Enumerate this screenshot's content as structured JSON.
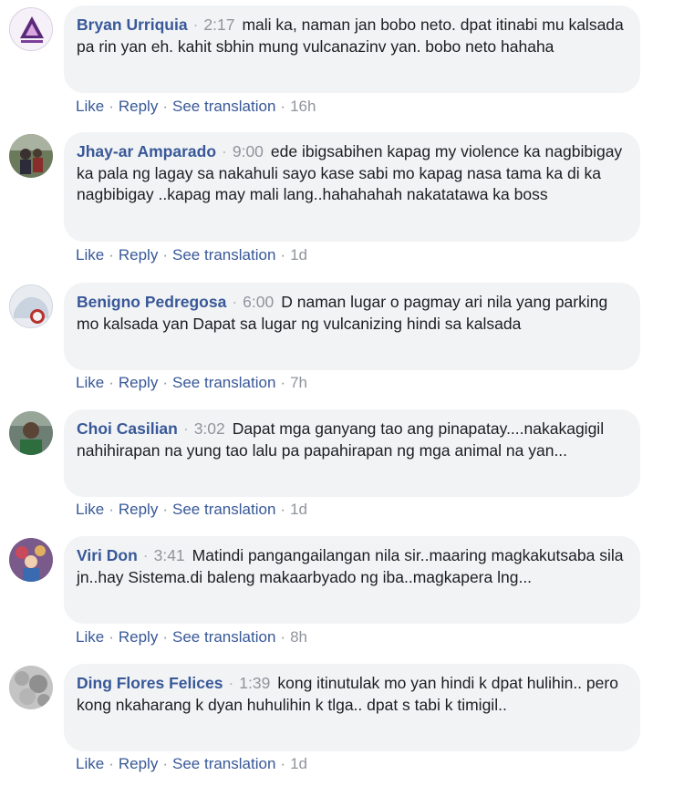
{
  "comments": [
    {
      "author": "Bryan Urriquia",
      "time": "2:17",
      "text": "mali ka, naman jan bobo neto. dpat itinabi mu kalsada pa rin yan eh. kahit sbhin mung vulcanazinv yan. bobo neto hahaha",
      "age": "16h"
    },
    {
      "author": "Jhay-ar Amparado",
      "time": "9:00",
      "text": "ede ibigsabihen kapag my violence ka nagbibigay ka pala ng lagay sa nakahuli sayo kase sabi mo kapag nasa tama ka di ka nagbibigay ..kapag may mali lang..hahahahah nakatatawa ka boss",
      "age": "1d"
    },
    {
      "author": "Benigno Pedregosa",
      "time": "6:00",
      "text": "D naman lugar o pagmay ari nila yang parking mo kalsada yan Dapat sa lugar ng vulcanizing hindi sa kalsada",
      "age": "7h"
    },
    {
      "author": "Choi Casilian",
      "time": "3:02",
      "text": "Dapat mga ganyang tao ang pinapatay....nakakagigil nahihirapan na yung tao lalu pa papahirapan ng mga animal na yan...",
      "age": "1d"
    },
    {
      "author": "Viri Don",
      "time": "3:41",
      "text": "Matindi pangangailangan nila sir..maaring magkakutsaba sila jn..hay Sistema.di baleng makaarbyado ng iba..magkapera lng...",
      "age": "8h"
    },
    {
      "author": "Ding Flores Felices",
      "time": "1:39",
      "text": "kong itinutulak mo yan hindi k dpat hulihin.. pero kong nkaharang k dyan huhulihin k tlga.. dpat s tabi k timigil..",
      "age": "1d"
    }
  ],
  "actions": {
    "like": "Like",
    "reply": "Reply",
    "see_translation": "See translation",
    "dot": "·"
  },
  "colors": {
    "link": "#385898",
    "muted": "#90949c",
    "bubble": "#f2f3f5",
    "text": "#1c1e21"
  }
}
